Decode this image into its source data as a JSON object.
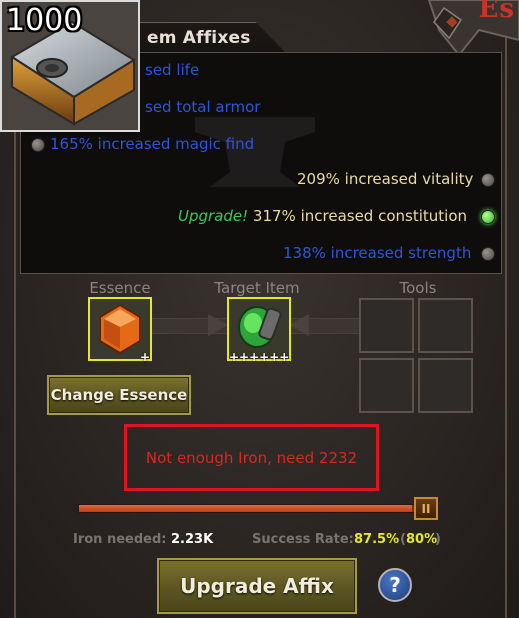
{
  "item": {
    "count": "1000"
  },
  "corner": {
    "text": "Es"
  },
  "affixes": {
    "title": "em Affixes",
    "lines": [
      {
        "text": "sed life"
      },
      {
        "text": "sed total armor"
      },
      {
        "text": "165% increased magic find"
      },
      {
        "text": "209% increased vitality"
      },
      {
        "prefix": "Upgrade!",
        "text": " 317% increased constitution"
      },
      {
        "text": "138% increased strength"
      }
    ]
  },
  "slots": {
    "essence_label": "Essence",
    "target_label": "Target Item",
    "tools_label": "Tools",
    "essence_plus": "+",
    "target_plus": "++++++"
  },
  "buttons": {
    "change_essence": "Change Essence",
    "upgrade_affix": "Upgrade Affix",
    "help": "?"
  },
  "warning": {
    "text": "Not enough Iron, need 2232"
  },
  "slider": {
    "fill_fraction": 0.93,
    "handle_glyph": "II"
  },
  "stats": {
    "iron_label": "Iron needed:",
    "iron_value": "2.23K",
    "success_label": "Success Rate:",
    "success_value": "87.5%",
    "success_paren_open": "(",
    "success_base": "80%",
    "success_paren_close": ")"
  },
  "colors": {
    "affix_blue": "#2f55d6",
    "affix_yellow": "#e8dba3",
    "upgrade_green": "#39c95a",
    "warning_red": "#d8281f",
    "slot_yellow": "#e6e62a"
  }
}
